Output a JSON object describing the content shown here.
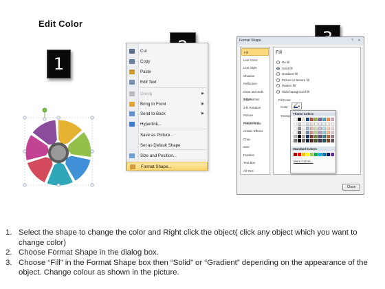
{
  "title": "Edit Color",
  "badges": [
    "1",
    "2",
    "3"
  ],
  "context_menu": {
    "items": [
      {
        "label": "Cut",
        "icon": "scissors-icon",
        "color": "#5a6f8a"
      },
      {
        "label": "Copy",
        "icon": "copy-icon",
        "color": "#6a7fa0"
      },
      {
        "label": "Paste",
        "icon": "clipboard-icon",
        "color": "#c89a2f"
      },
      {
        "label": "Edit Text",
        "icon": "edit-text-icon",
        "color": "#7b8fb0"
      },
      {
        "label": "Group",
        "icon": "group-icon",
        "color": "#b9b9b9",
        "disabled": true,
        "submenu": true
      },
      {
        "label": "Bring to Front",
        "icon": "bring-front-icon",
        "color": "#e0a53a",
        "submenu": true
      },
      {
        "label": "Send to Back",
        "icon": "send-back-icon",
        "color": "#6590cf",
        "submenu": true
      },
      {
        "label": "Hyperlink...",
        "icon": "hyperlink-icon",
        "color": "#3c78c8"
      },
      {
        "label": "Save as Picture...",
        "icon": "",
        "color": ""
      },
      {
        "label": "Set as Default Shape",
        "icon": "",
        "color": ""
      },
      {
        "label": "Size and Position...",
        "icon": "size-position-icon",
        "color": "#6d9ed6"
      },
      {
        "label": "Format Shape...",
        "icon": "format-shape-icon",
        "color": "#d69a3e",
        "highlighted": true
      }
    ]
  },
  "dialog": {
    "title": "Format Shape",
    "categories": [
      "Fill",
      "Line Color",
      "Line Style",
      "Shadow",
      "Reflection",
      "Glow and Soft Edges",
      "3-D Format",
      "3-D Rotation",
      "Picture Corrections",
      "Picture Color",
      "Artistic Effects",
      "Crop",
      "Size",
      "Position",
      "Text Box",
      "Alt Text"
    ],
    "selected_category": "Fill",
    "pane_heading": "Fill",
    "fill_options": [
      "No fill",
      "Solid fill",
      "Gradient fill",
      "Picture or texture fill",
      "Pattern fill",
      "Slide background fill"
    ],
    "selected_fill": "Solid fill",
    "fill_color_label": "Fill Color",
    "color_label": "Color:",
    "transparency_label": "Transpa",
    "palette": {
      "theme_heading": "Theme Colors",
      "standard_heading": "Standard Colors",
      "more_colors": "More Colors...",
      "theme_columns": [
        "#ffffff",
        "#000000",
        "#eeece1",
        "#1f497d",
        "#c0504d",
        "#9bbb59",
        "#8064a2",
        "#4bacc6",
        "#f79646",
        "#d7aec4"
      ],
      "standard": [
        "#c00000",
        "#ff0000",
        "#ffc000",
        "#ffff00",
        "#92d050",
        "#00b050",
        "#00b0f0",
        "#0070c0",
        "#002060",
        "#7030a0"
      ]
    },
    "close_label": "Close"
  },
  "wheel": {
    "colors": [
      "#8a4d9e",
      "#e6b232",
      "#93c04a",
      "#3f90d6",
      "#2fa7b8",
      "#d34a5c",
      "#c24293"
    ]
  },
  "steps": [
    {
      "num": "1.",
      "text": "Select the shape to change the color and Right click the object( click any object which you want to change color)"
    },
    {
      "num": "2.",
      "text": "Choose Format Shape in the dialog box."
    },
    {
      "num": "3.",
      "text": "Choose “Fill” in the Format Shape box then “Solid” or “Gradient” depending on the appearance of the object. Change colour as shown in the picture."
    }
  ]
}
